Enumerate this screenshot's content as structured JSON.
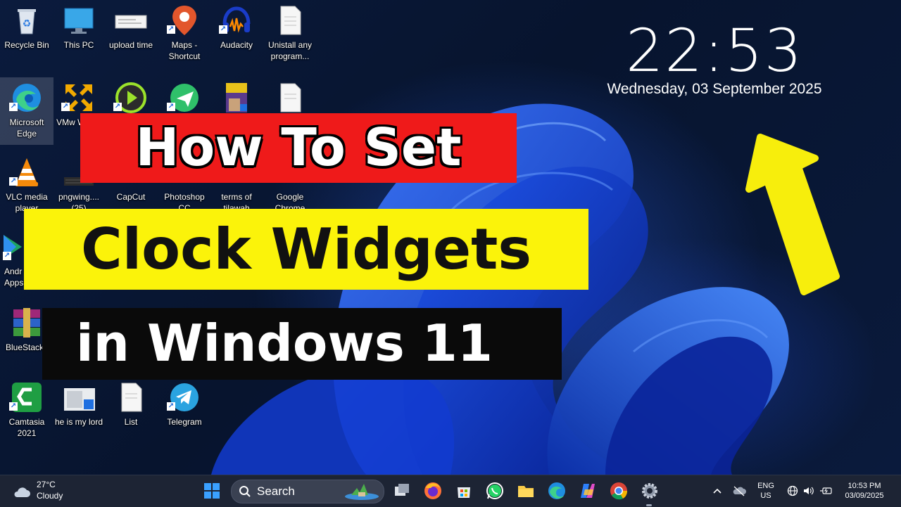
{
  "desktop": {
    "icons": [
      {
        "label": "Recycle Bin",
        "icon": "recycle-bin-icon"
      },
      {
        "label": "This PC",
        "icon": "monitor-icon"
      },
      {
        "label": "upload time",
        "icon": "document-icon"
      },
      {
        "label": "Maps - Shortcut",
        "icon": "map-pin-icon"
      },
      {
        "label": "Audacity",
        "icon": "audacity-icon"
      },
      {
        "label": "Unistall any program...",
        "icon": "text-file-icon"
      },
      {
        "label": "Microsoft Edge",
        "icon": "edge-icon"
      },
      {
        "label": "VMw Works",
        "icon": "vmware-icon"
      },
      {
        "label": "",
        "icon": "media-player-icon"
      },
      {
        "label": "",
        "icon": "send-arrow-icon"
      },
      {
        "label": "",
        "icon": "book-cover-icon"
      },
      {
        "label": "",
        "icon": "text-file-icon"
      },
      {
        "label": "VLC media player",
        "icon": "vlc-icon"
      },
      {
        "label": "pngwing.... (25)",
        "icon": "keyboard-image-icon"
      },
      {
        "label": "CapCut",
        "icon": "capcut-icon"
      },
      {
        "label": "Photoshop CC",
        "icon": "photoshop-icon"
      },
      {
        "label": "terms of tilawah",
        "icon": "document-icon"
      },
      {
        "label": "Google Chrome",
        "icon": "chrome-icon"
      },
      {
        "label": "Andr Apps",
        "icon": "play-store-icon"
      },
      {
        "label": "BlueStacks",
        "icon": "winrar-icon"
      },
      {
        "label": "Camtasia 2021",
        "icon": "camtasia-icon"
      },
      {
        "label": "he is my lord",
        "icon": "image-icon"
      },
      {
        "label": "List",
        "icon": "text-file-icon"
      },
      {
        "label": "Telegram",
        "icon": "telegram-icon"
      }
    ]
  },
  "clock_widget": {
    "time": "22:53",
    "date": "Wednesday, 03 September 2025"
  },
  "thumbnail_title": {
    "line1": "How To Set",
    "line2": "Clock Widgets",
    "line3": "in Windows 11",
    "colors": {
      "line1_bg": "#ef1a1a",
      "line2_bg": "#fbf30a",
      "line3_bg": "#0a0a0a",
      "arrow": "#fbf30a"
    }
  },
  "taskbar": {
    "weather": {
      "temp": "27°C",
      "condition": "Cloudy"
    },
    "search_placeholder": "Search",
    "pinned": [
      "windows-start-icon",
      "task-view-icon",
      "firefox-icon",
      "store-icon",
      "whatsapp-icon",
      "file-explorer-icon",
      "edge-icon",
      "copilot-icon",
      "chrome-icon",
      "settings-icon"
    ],
    "tray": {
      "lang_top": "ENG",
      "lang_bottom": "US",
      "time": "10:53 PM",
      "date": "03/09/2025"
    }
  }
}
